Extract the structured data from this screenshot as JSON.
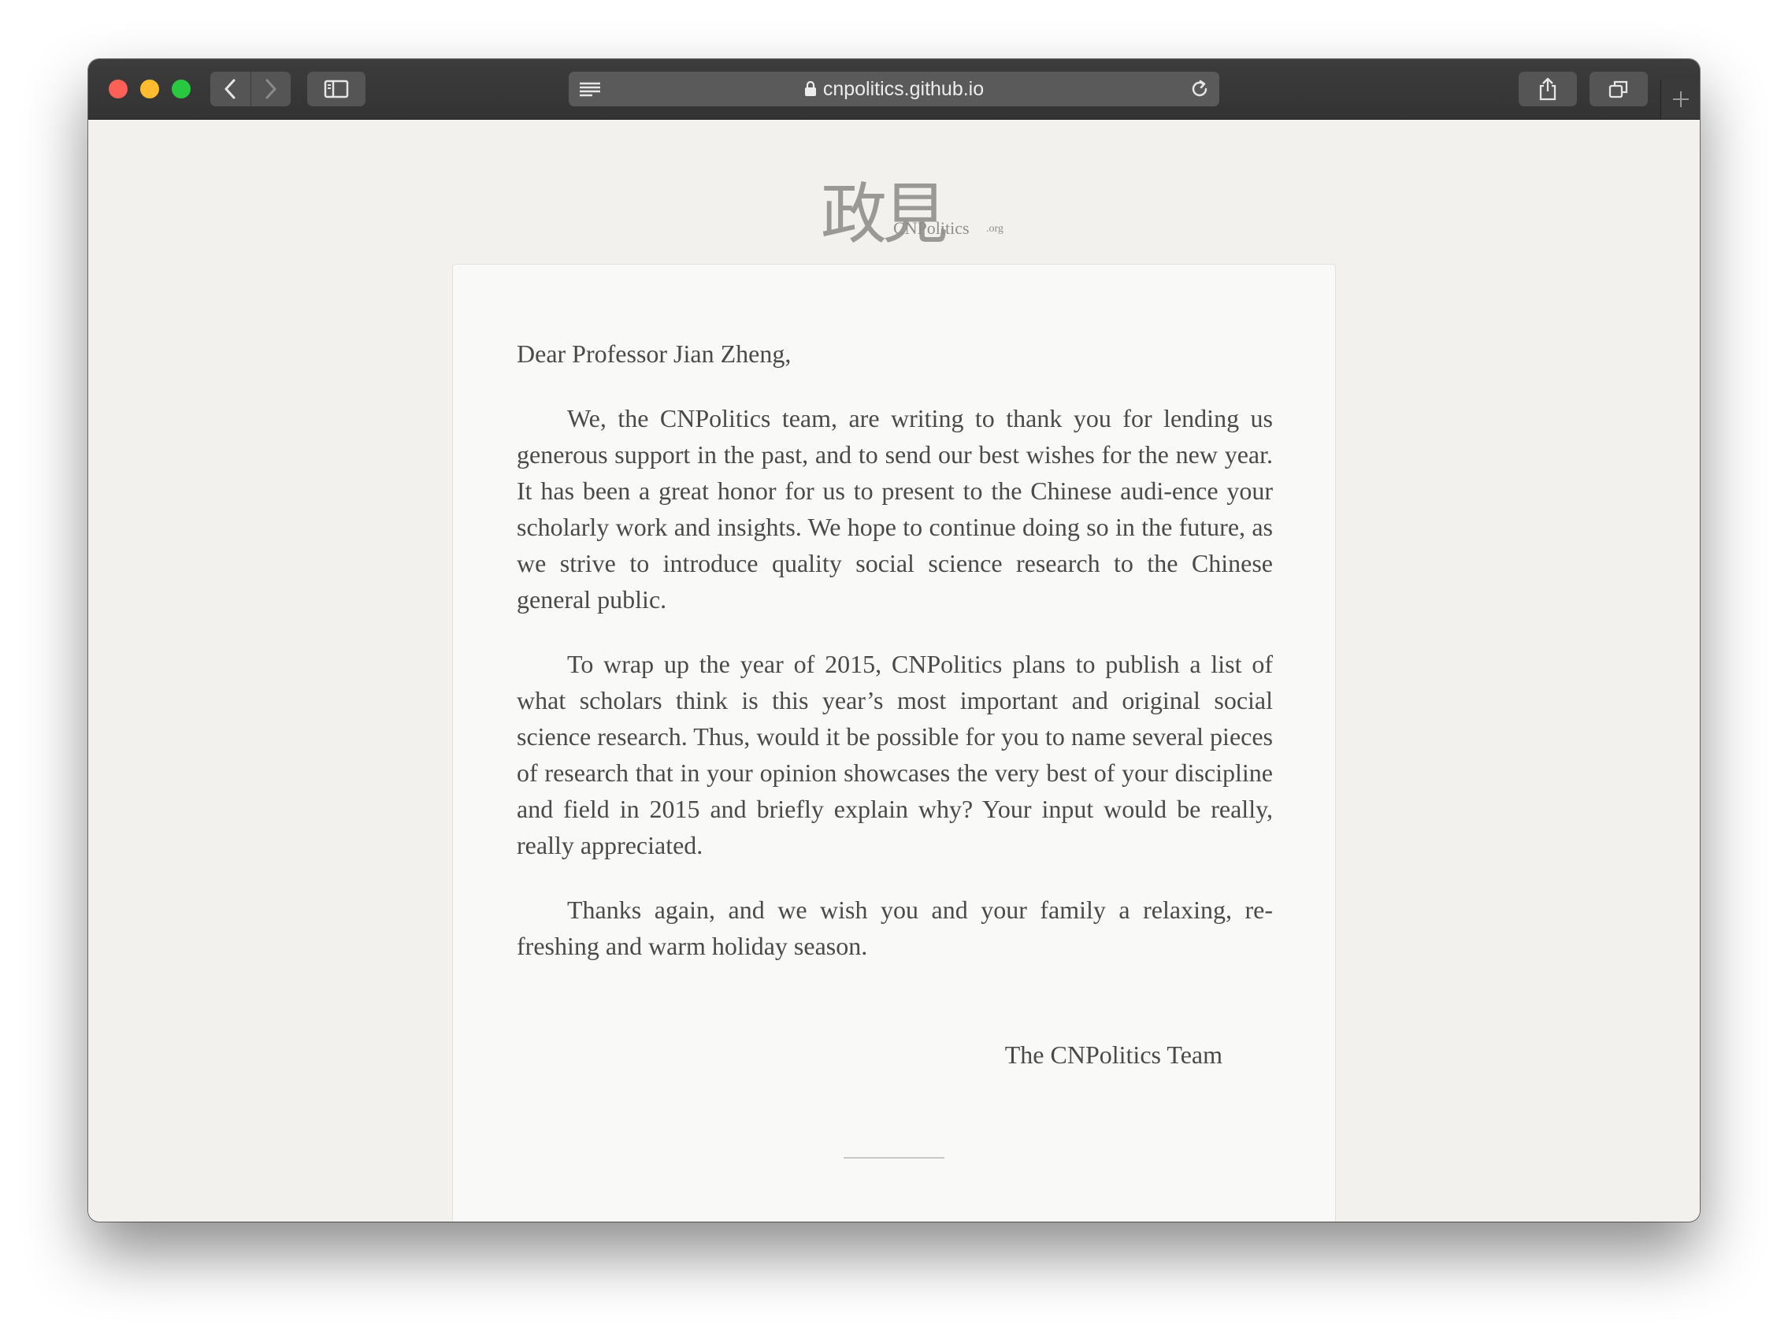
{
  "browser": {
    "url": "cnpolitics.github.io"
  },
  "logo": {
    "chinese": "政見",
    "english": "CNPolitics",
    "suffix": ".org"
  },
  "letter": {
    "salutation": "Dear Professor Jian Zheng,",
    "paragraphs": [
      "We, the CNPolitics team, are writing to thank you for lending us generous support in the past, and to send our best wishes for the new year. It has been a great honor for us to present to the Chinese audi-ence your scholarly work and insights. We hope to continue doing so in the future, as we strive to introduce quality social science research to the Chinese general public.",
      "To wrap up the year of 2015, CNPolitics plans to publish a list of what scholars think is this year’s most important and original social science research. Thus, would it be possible for you to name several pieces of research that in your opinion showcases the very best of your discipline and field in 2015 and briefly explain why? Your input would be really, really appreciated.",
      "Thanks again, and we wish you and your family a relaxing, re-freshing and warm holiday season."
    ],
    "signature": "The CNPolitics Team"
  },
  "colors": {
    "toolbar": "#353535",
    "page_background": "#f2f1ee",
    "letter_background": "#f9f9f8",
    "text": "#4a4a48"
  }
}
